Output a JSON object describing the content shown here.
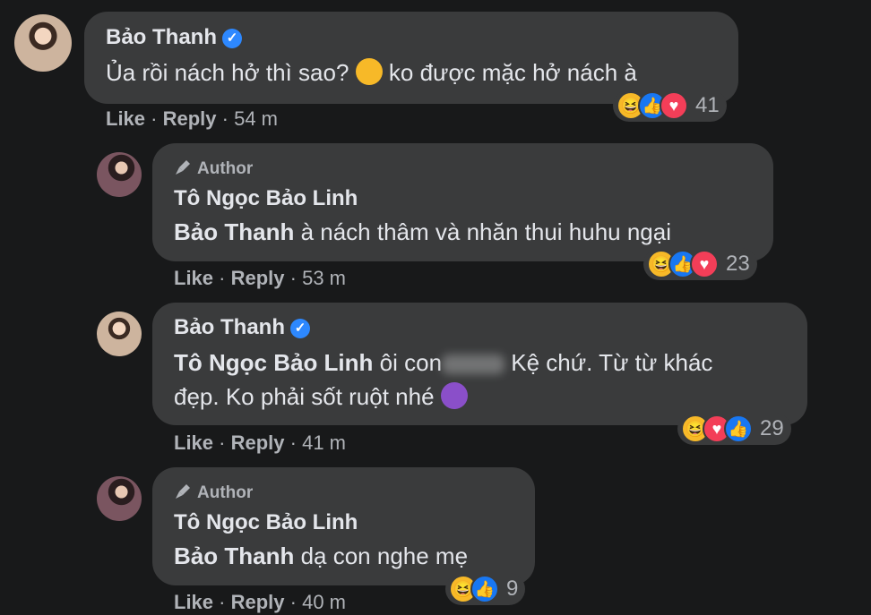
{
  "comments": [
    {
      "name": "Bảo Thanh",
      "verified": true,
      "author": false,
      "text": "Ủa rồi nách hở thì sao?",
      "text_after": "ko được mặc hở nách à",
      "emoji": "smirk",
      "like": "Like",
      "reply": "Reply",
      "time": "54 m",
      "reactions": [
        "haha",
        "like",
        "love"
      ],
      "count": "41"
    },
    {
      "name": "Tô Ngọc Bảo Linh",
      "author_label": "Author",
      "tag": "Bảo Thanh",
      "text": "à nách thâm và nhăn thui huhu ngại",
      "like": "Like",
      "reply": "Reply",
      "time": "53 m",
      "reactions": [
        "haha",
        "like",
        "love"
      ],
      "count": "23"
    },
    {
      "name": "Bảo Thanh",
      "verified": true,
      "tag": "Tô Ngọc Bảo Linh",
      "text": "ôi con",
      "text_after": "Kệ chứ. Từ từ khác",
      "line2": "đẹp. Ko phải sốt ruột nhé",
      "emoji": "devil",
      "like": "Like",
      "reply": "Reply",
      "time": "41 m",
      "reactions": [
        "haha",
        "love",
        "like"
      ],
      "count": "29"
    },
    {
      "name": "Tô Ngọc Bảo Linh",
      "author_label": "Author",
      "tag": "Bảo Thanh",
      "text": "dạ con nghe mẹ",
      "like": "Like",
      "reply": "Reply",
      "time": "40 m",
      "reactions": [
        "haha",
        "like"
      ],
      "count": "9"
    }
  ],
  "colors": {
    "background": "#18191a",
    "bubble": "#3a3b3c",
    "text": "#e4e6eb",
    "secondary": "#b0b3b8",
    "verified": "#2d88ff"
  }
}
